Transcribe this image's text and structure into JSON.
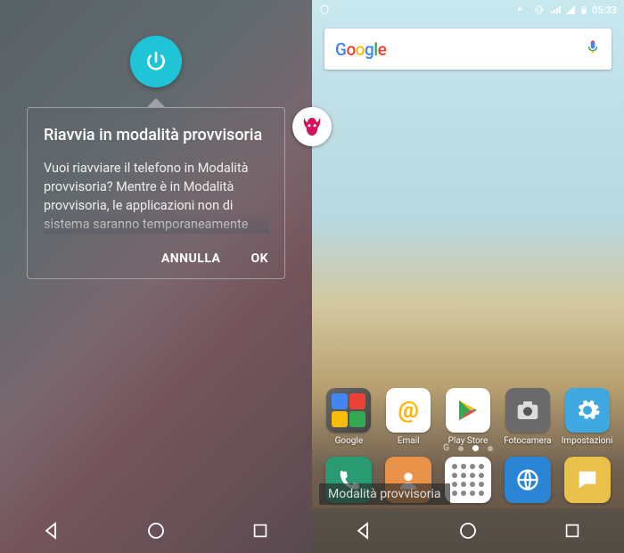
{
  "left": {
    "dialog": {
      "title": "Riavvia in modalità provvisoria",
      "body": "Vuoi riavviare il telefono in Modalità provvisoria? Mentre è in Modalità provvisoria, le applicazioni non di sistema saranno temporaneamente",
      "cancel": "ANNULLA",
      "ok": "OK"
    }
  },
  "right": {
    "status": {
      "time": "05:33"
    },
    "search": {
      "placeholder": "Google"
    },
    "apps": {
      "google": "Google",
      "email": "Email",
      "playstore": "Play Store",
      "camera": "Fotocamera",
      "settings": "Impostazioni"
    },
    "safe_mode_label": "Modalità provvisoria"
  }
}
